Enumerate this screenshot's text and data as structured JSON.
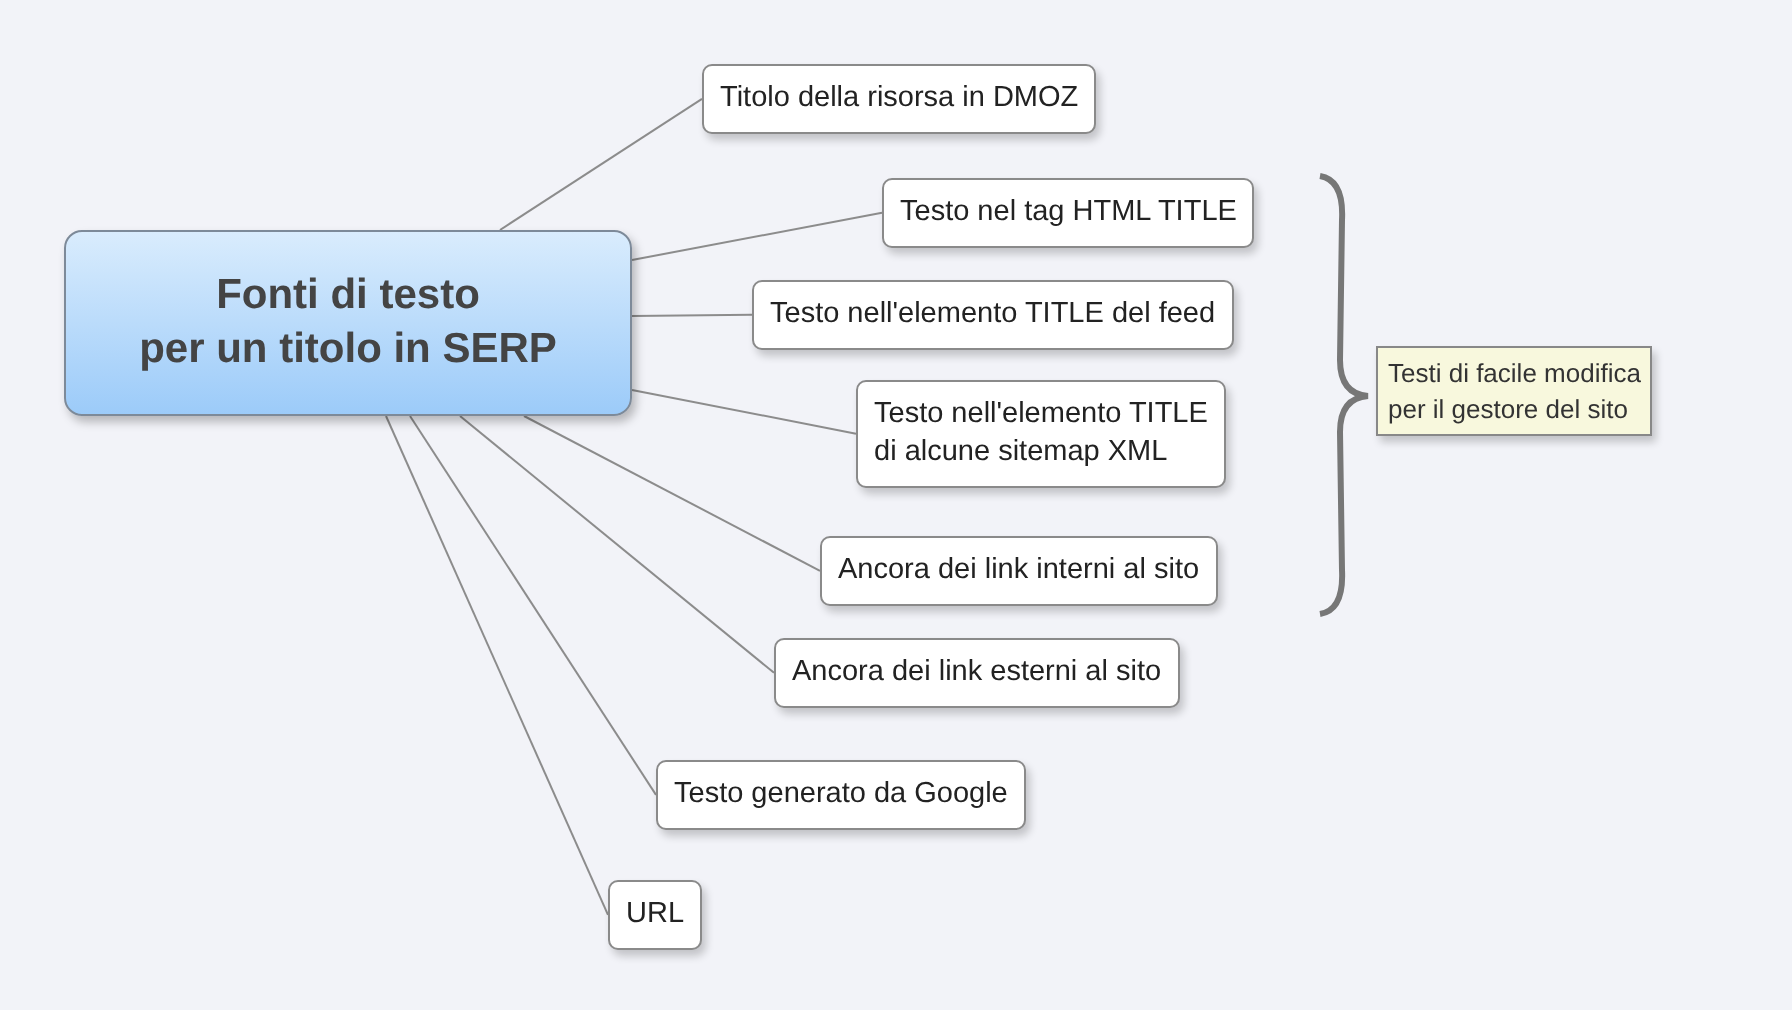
{
  "central_topic": {
    "lines": [
      "Fonti di testo",
      "per un titolo in SERP"
    ]
  },
  "subtopics": [
    {
      "lines": [
        "Titolo della risorsa in DMOZ"
      ]
    },
    {
      "lines": [
        "Testo nel tag HTML TITLE"
      ]
    },
    {
      "lines": [
        "Testo nell'elemento TITLE del feed"
      ]
    },
    {
      "lines": [
        "Testo nell'elemento TITLE",
        "di alcune sitemap XML"
      ]
    },
    {
      "lines": [
        "Ancora dei link interni al sito"
      ]
    },
    {
      "lines": [
        "Ancora dei link esterni al sito"
      ]
    },
    {
      "lines": [
        "Testo generato da Google"
      ]
    },
    {
      "lines": [
        "URL"
      ]
    }
  ],
  "summary": {
    "lines": [
      "Testi di facile modifica",
      "per il gestore del sito"
    ]
  }
}
